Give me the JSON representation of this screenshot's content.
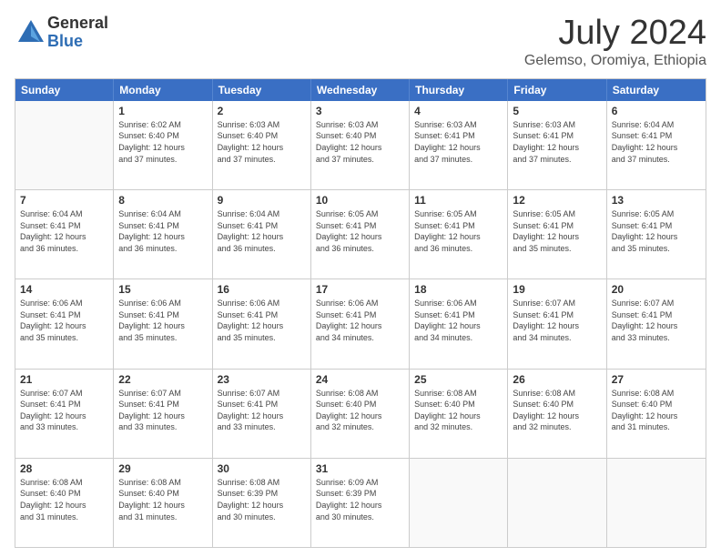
{
  "header": {
    "logo": {
      "line1": "General",
      "line2": "Blue"
    },
    "title": "July 2024",
    "subtitle": "Gelemso, Oromiya, Ethiopia"
  },
  "calendar": {
    "days_of_week": [
      "Sunday",
      "Monday",
      "Tuesday",
      "Wednesday",
      "Thursday",
      "Friday",
      "Saturday"
    ],
    "weeks": [
      [
        {
          "day": "",
          "sunrise": "",
          "sunset": "",
          "daylight": ""
        },
        {
          "day": "1",
          "sunrise": "Sunrise: 6:02 AM",
          "sunset": "Sunset: 6:40 PM",
          "daylight": "Daylight: 12 hours and 37 minutes."
        },
        {
          "day": "2",
          "sunrise": "Sunrise: 6:03 AM",
          "sunset": "Sunset: 6:40 PM",
          "daylight": "Daylight: 12 hours and 37 minutes."
        },
        {
          "day": "3",
          "sunrise": "Sunrise: 6:03 AM",
          "sunset": "Sunset: 6:40 PM",
          "daylight": "Daylight: 12 hours and 37 minutes."
        },
        {
          "day": "4",
          "sunrise": "Sunrise: 6:03 AM",
          "sunset": "Sunset: 6:41 PM",
          "daylight": "Daylight: 12 hours and 37 minutes."
        },
        {
          "day": "5",
          "sunrise": "Sunrise: 6:03 AM",
          "sunset": "Sunset: 6:41 PM",
          "daylight": "Daylight: 12 hours and 37 minutes."
        },
        {
          "day": "6",
          "sunrise": "Sunrise: 6:04 AM",
          "sunset": "Sunset: 6:41 PM",
          "daylight": "Daylight: 12 hours and 37 minutes."
        }
      ],
      [
        {
          "day": "7",
          "sunrise": "Sunrise: 6:04 AM",
          "sunset": "Sunset: 6:41 PM",
          "daylight": "Daylight: 12 hours and 36 minutes."
        },
        {
          "day": "8",
          "sunrise": "Sunrise: 6:04 AM",
          "sunset": "Sunset: 6:41 PM",
          "daylight": "Daylight: 12 hours and 36 minutes."
        },
        {
          "day": "9",
          "sunrise": "Sunrise: 6:04 AM",
          "sunset": "Sunset: 6:41 PM",
          "daylight": "Daylight: 12 hours and 36 minutes."
        },
        {
          "day": "10",
          "sunrise": "Sunrise: 6:05 AM",
          "sunset": "Sunset: 6:41 PM",
          "daylight": "Daylight: 12 hours and 36 minutes."
        },
        {
          "day": "11",
          "sunrise": "Sunrise: 6:05 AM",
          "sunset": "Sunset: 6:41 PM",
          "daylight": "Daylight: 12 hours and 36 minutes."
        },
        {
          "day": "12",
          "sunrise": "Sunrise: 6:05 AM",
          "sunset": "Sunset: 6:41 PM",
          "daylight": "Daylight: 12 hours and 35 minutes."
        },
        {
          "day": "13",
          "sunrise": "Sunrise: 6:05 AM",
          "sunset": "Sunset: 6:41 PM",
          "daylight": "Daylight: 12 hours and 35 minutes."
        }
      ],
      [
        {
          "day": "14",
          "sunrise": "Sunrise: 6:06 AM",
          "sunset": "Sunset: 6:41 PM",
          "daylight": "Daylight: 12 hours and 35 minutes."
        },
        {
          "day": "15",
          "sunrise": "Sunrise: 6:06 AM",
          "sunset": "Sunset: 6:41 PM",
          "daylight": "Daylight: 12 hours and 35 minutes."
        },
        {
          "day": "16",
          "sunrise": "Sunrise: 6:06 AM",
          "sunset": "Sunset: 6:41 PM",
          "daylight": "Daylight: 12 hours and 35 minutes."
        },
        {
          "day": "17",
          "sunrise": "Sunrise: 6:06 AM",
          "sunset": "Sunset: 6:41 PM",
          "daylight": "Daylight: 12 hours and 34 minutes."
        },
        {
          "day": "18",
          "sunrise": "Sunrise: 6:06 AM",
          "sunset": "Sunset: 6:41 PM",
          "daylight": "Daylight: 12 hours and 34 minutes."
        },
        {
          "day": "19",
          "sunrise": "Sunrise: 6:07 AM",
          "sunset": "Sunset: 6:41 PM",
          "daylight": "Daylight: 12 hours and 34 minutes."
        },
        {
          "day": "20",
          "sunrise": "Sunrise: 6:07 AM",
          "sunset": "Sunset: 6:41 PM",
          "daylight": "Daylight: 12 hours and 33 minutes."
        }
      ],
      [
        {
          "day": "21",
          "sunrise": "Sunrise: 6:07 AM",
          "sunset": "Sunset: 6:41 PM",
          "daylight": "Daylight: 12 hours and 33 minutes."
        },
        {
          "day": "22",
          "sunrise": "Sunrise: 6:07 AM",
          "sunset": "Sunset: 6:41 PM",
          "daylight": "Daylight: 12 hours and 33 minutes."
        },
        {
          "day": "23",
          "sunrise": "Sunrise: 6:07 AM",
          "sunset": "Sunset: 6:41 PM",
          "daylight": "Daylight: 12 hours and 33 minutes."
        },
        {
          "day": "24",
          "sunrise": "Sunrise: 6:08 AM",
          "sunset": "Sunset: 6:40 PM",
          "daylight": "Daylight: 12 hours and 32 minutes."
        },
        {
          "day": "25",
          "sunrise": "Sunrise: 6:08 AM",
          "sunset": "Sunset: 6:40 PM",
          "daylight": "Daylight: 12 hours and 32 minutes."
        },
        {
          "day": "26",
          "sunrise": "Sunrise: 6:08 AM",
          "sunset": "Sunset: 6:40 PM",
          "daylight": "Daylight: 12 hours and 32 minutes."
        },
        {
          "day": "27",
          "sunrise": "Sunrise: 6:08 AM",
          "sunset": "Sunset: 6:40 PM",
          "daylight": "Daylight: 12 hours and 31 minutes."
        }
      ],
      [
        {
          "day": "28",
          "sunrise": "Sunrise: 6:08 AM",
          "sunset": "Sunset: 6:40 PM",
          "daylight": "Daylight: 12 hours and 31 minutes."
        },
        {
          "day": "29",
          "sunrise": "Sunrise: 6:08 AM",
          "sunset": "Sunset: 6:40 PM",
          "daylight": "Daylight: 12 hours and 31 minutes."
        },
        {
          "day": "30",
          "sunrise": "Sunrise: 6:08 AM",
          "sunset": "Sunset: 6:39 PM",
          "daylight": "Daylight: 12 hours and 30 minutes."
        },
        {
          "day": "31",
          "sunrise": "Sunrise: 6:09 AM",
          "sunset": "Sunset: 6:39 PM",
          "daylight": "Daylight: 12 hours and 30 minutes."
        },
        {
          "day": "",
          "sunrise": "",
          "sunset": "",
          "daylight": ""
        },
        {
          "day": "",
          "sunrise": "",
          "sunset": "",
          "daylight": ""
        },
        {
          "day": "",
          "sunrise": "",
          "sunset": "",
          "daylight": ""
        }
      ]
    ]
  }
}
